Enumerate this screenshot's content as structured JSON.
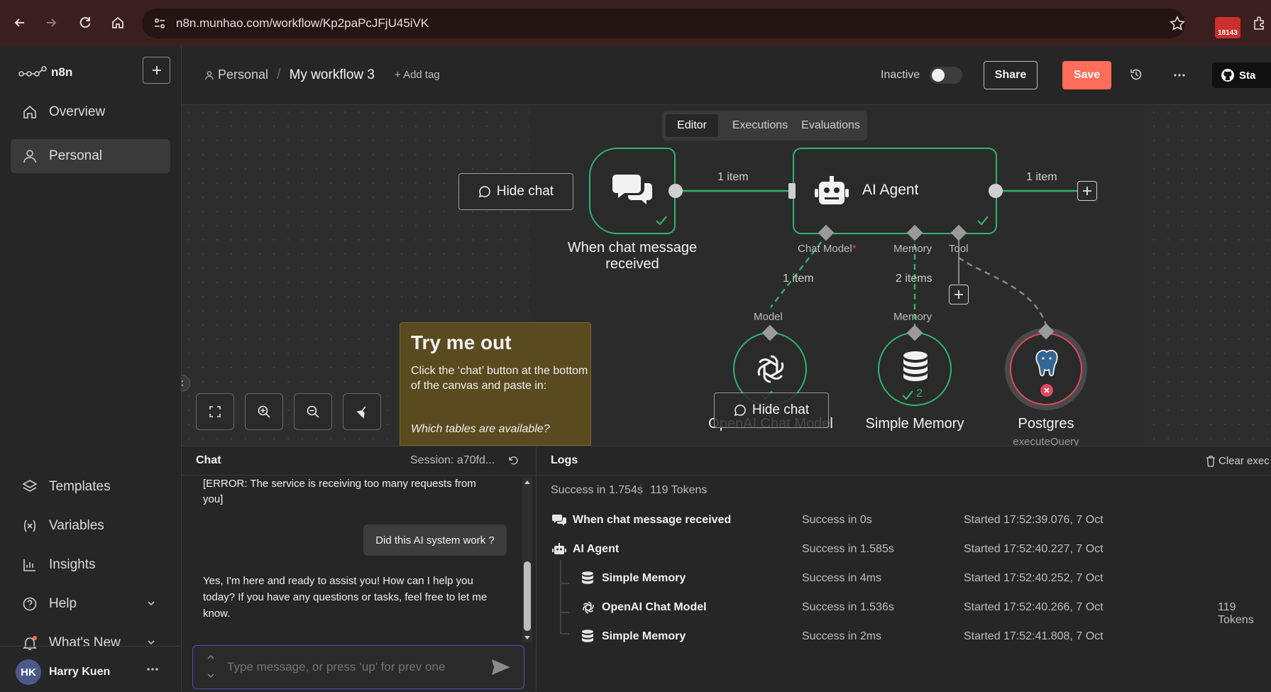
{
  "browser": {
    "url": "n8n.munhao.com/workflow/Kp2paPcJFjU45iVK",
    "extension_count": "18143"
  },
  "sidebar": {
    "brand": "n8n",
    "items": [
      {
        "label": "Overview",
        "icon": "home-icon"
      },
      {
        "label": "Personal",
        "icon": "user-icon"
      }
    ],
    "bottom_items": [
      {
        "label": "Templates",
        "icon": "templates-icon"
      },
      {
        "label": "Variables",
        "icon": "variables-icon"
      },
      {
        "label": "Insights",
        "icon": "insights-icon"
      },
      {
        "label": "Help",
        "icon": "help-icon"
      },
      {
        "label": "What's New",
        "icon": "bell-icon"
      }
    ],
    "user": {
      "initials": "HK",
      "name": "Harry Kuen"
    }
  },
  "header": {
    "breadcrumb_project": "Personal",
    "workflow_name": "My workflow 3",
    "add_tag": "+ Add tag",
    "status": "Inactive",
    "share": "Share",
    "save": "Save",
    "github": "Sta"
  },
  "tabs": [
    "Editor",
    "Executions",
    "Evaluations"
  ],
  "canvas": {
    "hide_chat": "Hide chat",
    "nodes": {
      "trigger": "When chat message received",
      "agent": "AI Agent",
      "model": "OpenAI Chat Model",
      "memory": "Simple Memory",
      "postgres": "Postgres",
      "postgres_sub": "executeQuery",
      "memory_count": "2"
    },
    "edges": {
      "trigger_agent": "1 item",
      "agent_out": "1 item",
      "model_items": "1 item",
      "memory_items": "2 items"
    },
    "ports": {
      "chat_model": "Chat Model",
      "chat_model_required": "*",
      "memory": "Memory",
      "tool": "Tool",
      "model_in": "Model",
      "memory_in": "Memory"
    },
    "sticky": {
      "title": "Try me out",
      "body": "Click the ‘chat’ button at the bottom of the canvas and paste in:",
      "example": "Which tables are available?"
    }
  },
  "chat": {
    "title": "Chat",
    "session": "Session: a70fd...",
    "messages": [
      {
        "role": "bot",
        "text": "[ERROR: The service is receiving too many requests from you]"
      },
      {
        "role": "user",
        "text": "Did this AI system work ?"
      },
      {
        "role": "bot",
        "text": "Yes, I'm here and ready to assist you! How can I help you today? If you have any questions or tasks, feel free to let me know."
      }
    ],
    "input_placeholder": "Type message, or press ‘up’ for prev one"
  },
  "logs": {
    "title": "Logs",
    "clear": "Clear exec",
    "summary_status": "Success in 1.754s",
    "summary_tokens": "119 Tokens",
    "rows": [
      {
        "name": "When chat message received",
        "status": "Success in 0s",
        "started": "Started 17:52:39.076, 7 Oct",
        "tokens": ""
      },
      {
        "name": "AI Agent",
        "status": "Success in 1.585s",
        "started": "Started 17:52:40.227, 7 Oct",
        "tokens": ""
      },
      {
        "name": "Simple Memory",
        "status": "Success in 4ms",
        "started": "Started 17:52:40.252, 7 Oct",
        "tokens": ""
      },
      {
        "name": "OpenAI Chat Model",
        "status": "Success in 1.536s",
        "started": "Started 17:52:40.266, 7 Oct",
        "tokens": "119 Tokens"
      },
      {
        "name": "Simple Memory",
        "status": "Success in 2ms",
        "started": "Started 17:52:41.808, 7 Oct",
        "tokens": ""
      }
    ]
  },
  "colors": {
    "accent": "#ff6d5a",
    "success": "#2fb36b",
    "error": "#e0485c",
    "sticky": "#5a4a1f"
  }
}
